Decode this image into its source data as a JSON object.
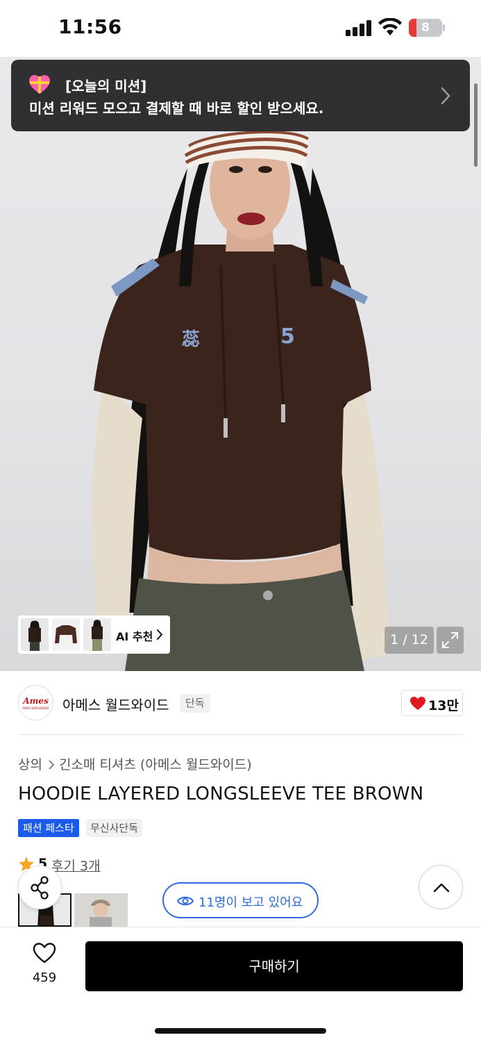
{
  "status_bar": {
    "time": "11:56",
    "battery_level": "8",
    "icons": [
      "signal-icon",
      "wifi-icon",
      "battery-icon"
    ]
  },
  "mission_banner": {
    "title": "[오늘의 미션]",
    "description": "미션 리워드 모으고 결제할 때 바로 할인 받으세요.",
    "icon": "gift-heart-icon"
  },
  "gallery": {
    "counter": "1 / 12",
    "ai_recommend_label": "AI 추천",
    "current_page": 1,
    "total_pages": 12
  },
  "brand": {
    "logo_text": "Ames",
    "logo_subtext": "AMES WORLDWIDE",
    "name": "아메스 월드와이드",
    "exclusive_badge": "단독",
    "like_count": "13만",
    "accent_color": "#e0181f"
  },
  "breadcrumb": {
    "items": [
      "상의",
      "긴소매 티셔츠 (아메스 월드와이드)"
    ]
  },
  "product": {
    "title": "HOODIE LAYERED LONGSLEEVE TEE BROWN",
    "tags": [
      "패션 페스타",
      "무신사단독"
    ],
    "tag_festa_color": "#1a5bea",
    "rating_score": "5",
    "review_link": "후기 3개"
  },
  "viewers": {
    "text": "11명이 보고 있어요",
    "color": "#2f6be0"
  },
  "bottom_bar": {
    "wish_count": "459",
    "buy_label": "구매하기"
  }
}
